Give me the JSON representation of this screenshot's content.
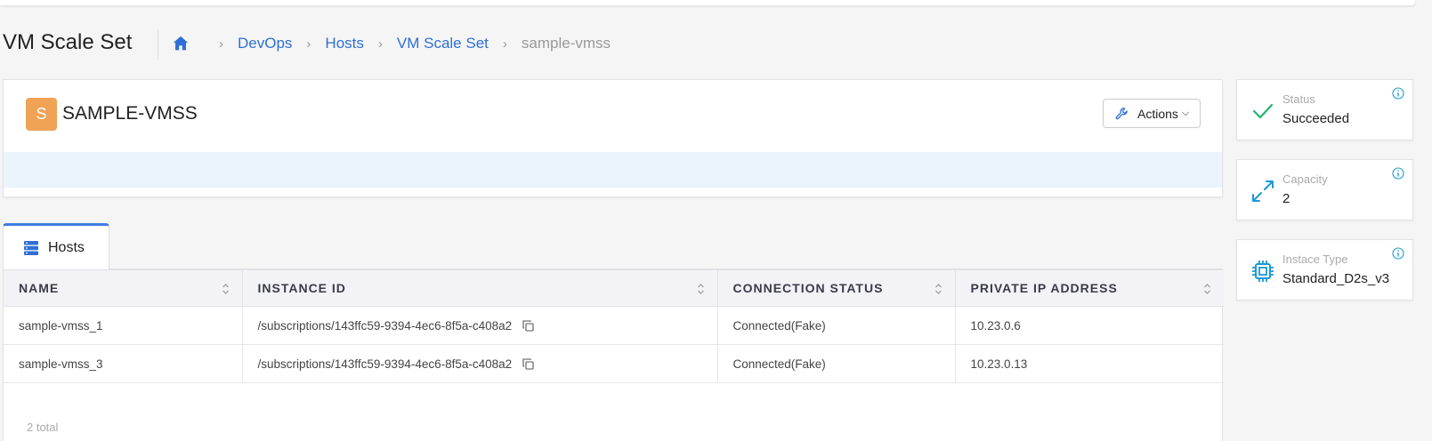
{
  "page": {
    "title": "VM Scale Set"
  },
  "breadcrumb": {
    "items": [
      "DevOps",
      "Hosts",
      "VM Scale Set"
    ],
    "current": "sample-vmss"
  },
  "resource": {
    "avatar_letter": "S",
    "name": "SAMPLE-VMSS",
    "actions_label": "Actions",
    "avatar_color": "#f0a255"
  },
  "status_cards": [
    {
      "label": "Status",
      "value": "Succeeded",
      "icon": "check-icon"
    },
    {
      "label": "Capacity",
      "value": "2",
      "icon": "expand-icon"
    },
    {
      "label": "Instace Type",
      "value": "Standard_D2s_v3",
      "icon": "cpu-icon"
    }
  ],
  "tabs": [
    {
      "label": "Hosts",
      "icon": "server-icon"
    }
  ],
  "table": {
    "columns": [
      "NAME",
      "INSTANCE ID",
      "CONNECTION STATUS",
      "PRIVATE IP ADDRESS"
    ],
    "rows": [
      {
        "name": "sample-vmss_1",
        "instance_id": "/subscriptions/143ffc59-9394-4ec6-8f5a-c408a2",
        "status": "Connected(Fake)",
        "ip": "10.23.0.6"
      },
      {
        "name": "sample-vmss_3",
        "instance_id": "/subscriptions/143ffc59-9394-4ec6-8f5a-c408a2",
        "status": "Connected(Fake)",
        "ip": "10.23.0.13"
      }
    ],
    "total": "2 total"
  },
  "colors": {
    "accent": "#2f6fd6",
    "success": "#22b573",
    "info": "#1a9ad6"
  }
}
